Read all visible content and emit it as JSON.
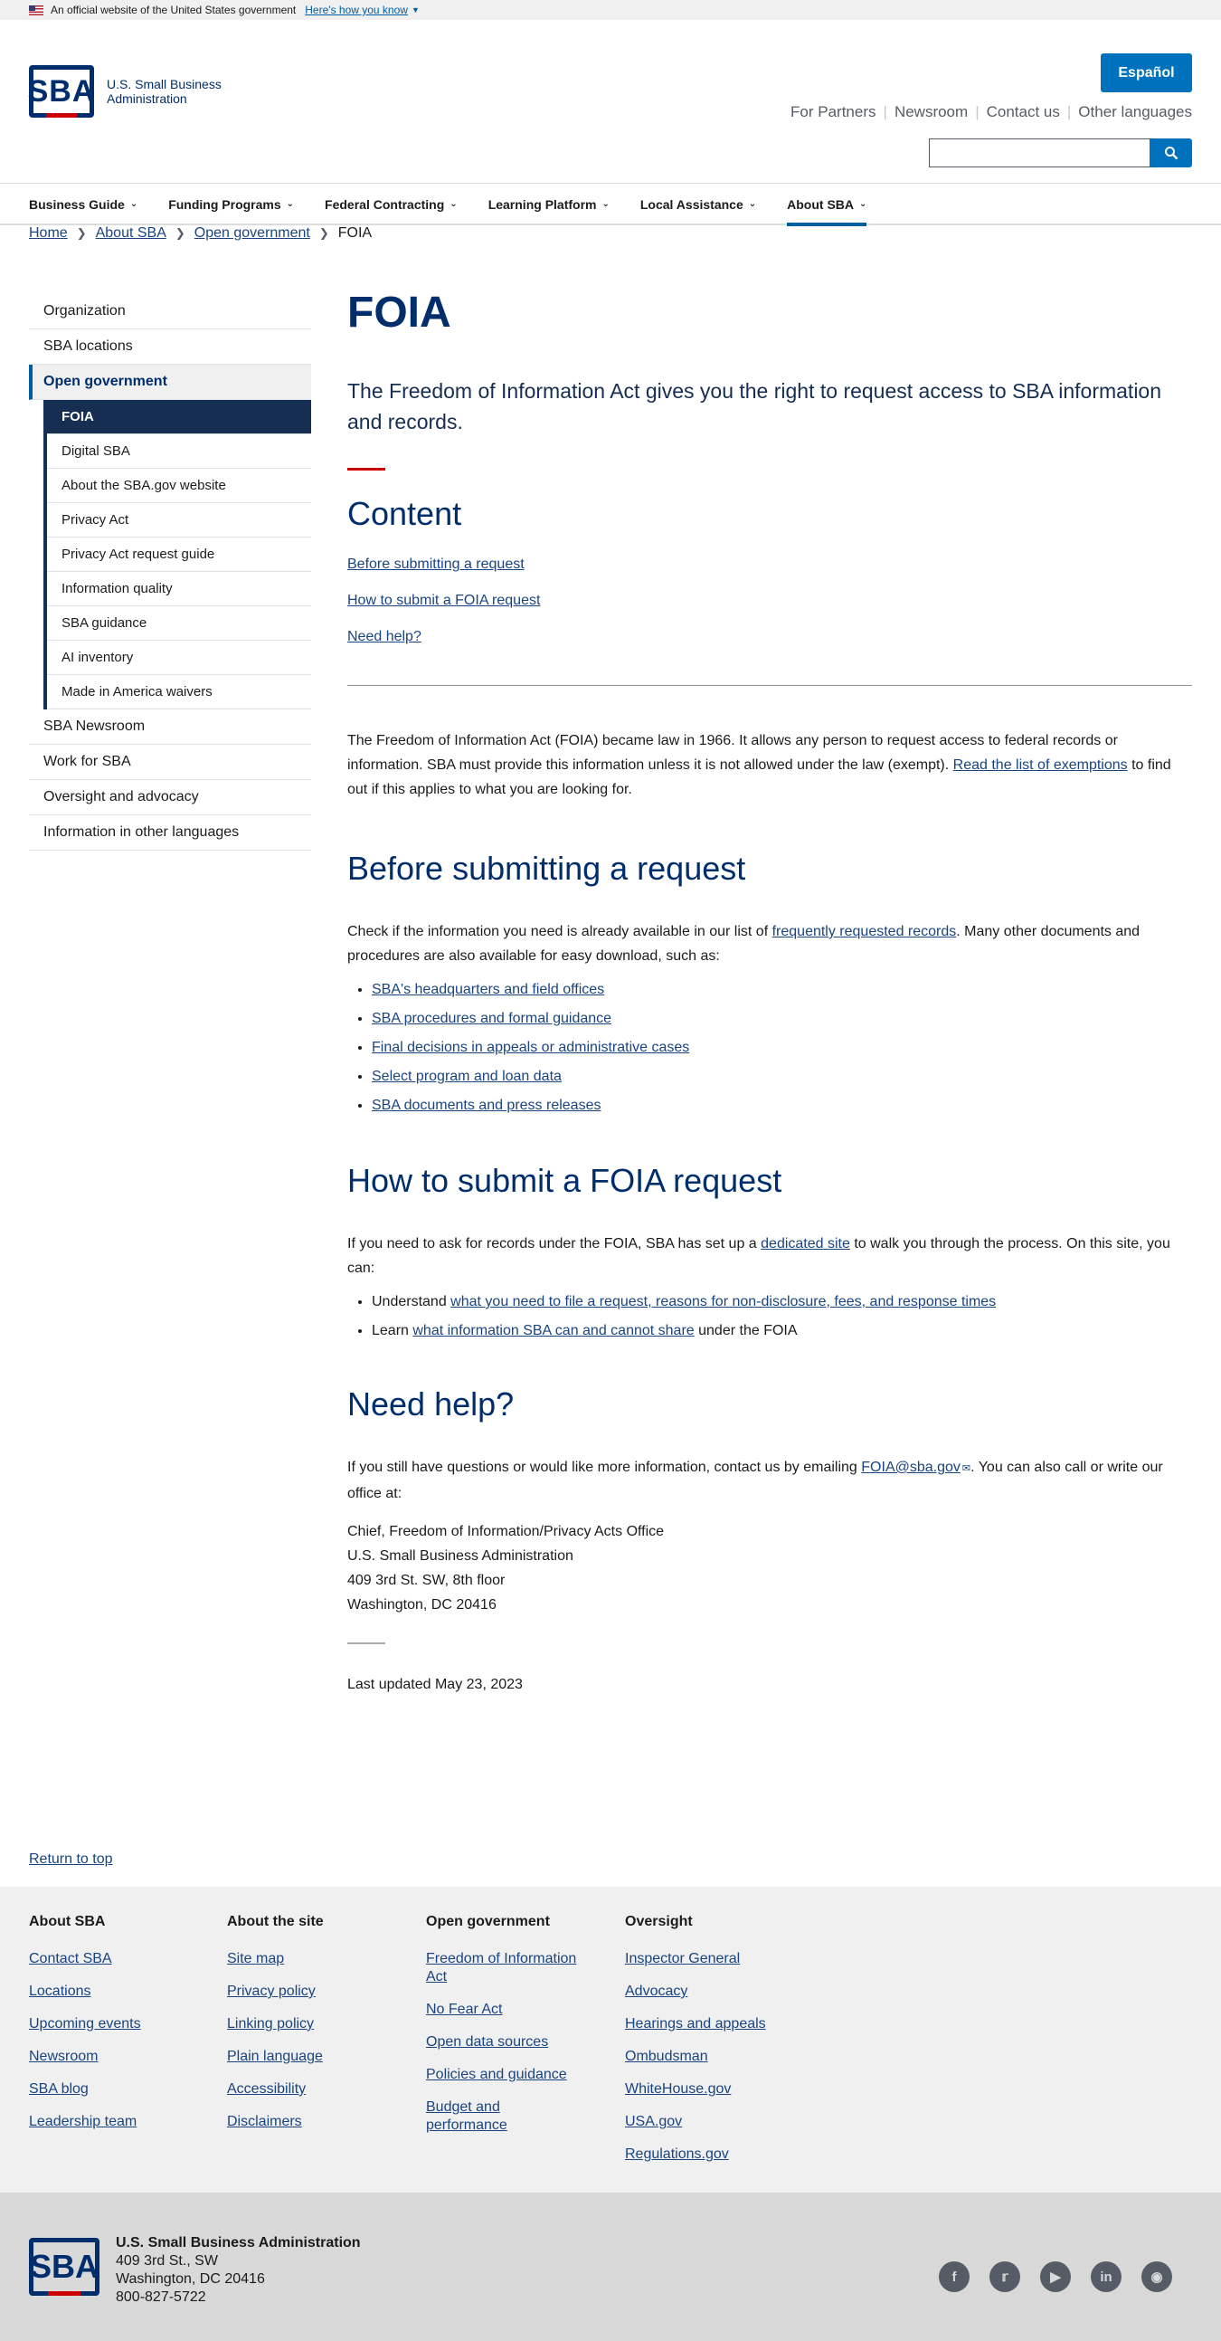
{
  "banner": {
    "text": "An official website of the United States government",
    "link": "Here's how you know"
  },
  "header": {
    "logo_line1": "U.S. Small Business",
    "logo_line2": "Administration",
    "logo_mark": "SBA",
    "espanol": "Español",
    "utility": [
      "For Partners",
      "Newsroom",
      "Contact us",
      "Other languages"
    ],
    "search_placeholder": ""
  },
  "nav": [
    "Business Guide",
    "Funding Programs",
    "Federal Contracting",
    "Learning Platform",
    "Local Assistance",
    "About SBA"
  ],
  "breadcrumb": {
    "items": [
      "Home",
      "About SBA",
      "Open government"
    ],
    "current": "FOIA"
  },
  "sidebar": {
    "top": [
      "Organization",
      "SBA locations"
    ],
    "current": "Open government",
    "sub": [
      "FOIA",
      "Digital SBA",
      "About the SBA.gov website",
      "Privacy Act",
      "Privacy Act request guide",
      "Information quality",
      "SBA guidance",
      "AI inventory",
      "Made in America waivers"
    ],
    "bottom": [
      "SBA Newsroom",
      "Work for SBA",
      "Oversight and advocacy",
      "Information in other languages"
    ]
  },
  "main": {
    "title": "FOIA",
    "lead": "The Freedom of Information Act gives you the right to request access to SBA information and records.",
    "content_heading": "Content",
    "toc": [
      "Before submitting a request",
      "How to submit a FOIA request",
      "Need help?"
    ],
    "intro_1": "The Freedom of Information Act (FOIA) became law in 1966. It allows any person to request access to federal records or information. SBA must provide this information unless it is not allowed under the law (exempt). ",
    "intro_link": "Read the list of exemptions",
    "intro_2": " to find out if this applies to what you are looking for.",
    "before_heading": "Before submitting a request",
    "before_1": "Check if the information you need is already available in our list of ",
    "before_link": "frequently requested records",
    "before_2": ".  Many other documents and procedures are also available for easy download, such as:",
    "before_list": [
      "SBA's headquarters and field offices",
      "SBA procedures and formal guidance",
      "Final decisions in appeals or administrative cases",
      "Select program and loan data",
      "SBA documents and press releases"
    ],
    "how_heading": "How to submit a FOIA request",
    "how_1": "If you need to ask for records under the FOIA, SBA has set up a ",
    "how_link": "dedicated site",
    "how_2": " to walk you through the process. On this site, you can:",
    "how_li1_pre": "Understand ",
    "how_li1_link": "what you need to file a request, reasons for non-disclosure, fees, and response times",
    "how_li2_pre": "Learn ",
    "how_li2_link": "what information SBA can and cannot share",
    "how_li2_post": " under the FOIA",
    "help_heading": "Need help?",
    "help_1": "If you still have questions or would like more information, contact us by emailing ",
    "help_email": "FOIA@sba.gov",
    "help_2": ". You can also call or write our office at:",
    "address": [
      "Chief, Freedom of Information/Privacy Acts Office",
      "U.S. Small Business Administration",
      "409 3rd St. SW, 8th floor",
      "Washington, DC 20416"
    ],
    "updated": "Last updated May 23, 2023"
  },
  "return_top": "Return to top",
  "footer": {
    "cols": [
      {
        "title": "About SBA",
        "links": [
          "Contact SBA",
          "Locations",
          "Upcoming events",
          "Newsroom",
          "SBA blog",
          "Leadership team"
        ]
      },
      {
        "title": "About the site",
        "links": [
          "Site map",
          "Privacy policy",
          "Linking policy",
          "Plain language",
          "Accessibility",
          "Disclaimers"
        ]
      },
      {
        "title": "Open government",
        "links": [
          "Freedom of Information Act",
          "No Fear Act",
          "Open data sources",
          "Policies and guidance",
          "Budget and performance"
        ]
      },
      {
        "title": "Oversight",
        "links": [
          "Inspector General",
          "Advocacy",
          "Hearings and appeals",
          "Ombudsman",
          "WhiteHouse.gov",
          "USA.gov",
          "Regulations.gov"
        ]
      }
    ]
  },
  "bottom": {
    "name": "U.S. Small Business Administration",
    "addr1": "409 3rd St., SW",
    "addr2": "Washington, DC 20416",
    "phone": "800-827-5722",
    "social": [
      "facebook-icon",
      "twitter-icon",
      "youtube-icon",
      "linkedin-icon",
      "instagram-icon"
    ]
  }
}
